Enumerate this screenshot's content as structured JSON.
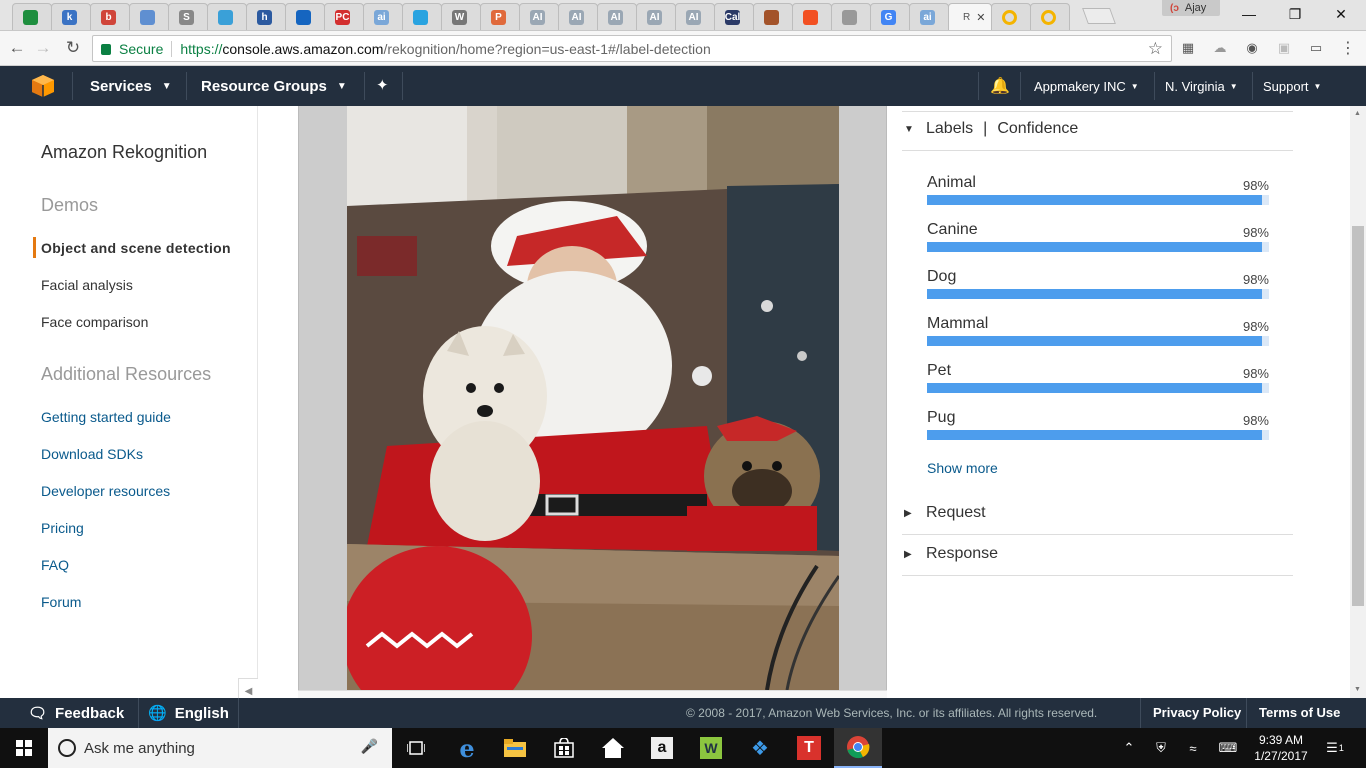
{
  "browser": {
    "tabs": [
      {
        "letter": "",
        "color": "#1e8e3e",
        "icon": "sheets-icon"
      },
      {
        "letter": "k",
        "color": "#3b73c4",
        "icon": "k-icon"
      },
      {
        "letter": "b",
        "color": "#d0453a",
        "icon": "b-icon"
      },
      {
        "letter": "",
        "color": "#5f8fd1",
        "icon": "doc-icon"
      },
      {
        "letter": "S",
        "color": "#888888",
        "icon": "s-icon"
      },
      {
        "letter": "",
        "color": "#3aa0d8",
        "icon": "circle-icon"
      },
      {
        "letter": "h",
        "color": "#2c5aa0",
        "icon": "h-icon"
      },
      {
        "letter": "",
        "color": "#1565c0",
        "icon": "globe-icon"
      },
      {
        "letter": "PC",
        "color": "#d32f2f",
        "icon": "pc-icon"
      },
      {
        "letter": "ai",
        "color": "#7aa7d8",
        "icon": "ai-icon"
      },
      {
        "letter": "",
        "color": "#29a3e0",
        "icon": "check-icon"
      },
      {
        "letter": "W",
        "color": "#777777",
        "icon": "wikipedia-icon"
      },
      {
        "letter": "P",
        "color": "#e06a3c",
        "icon": "p-icon"
      },
      {
        "letter": "AI",
        "color": "#9aa7b4",
        "icon": "ai-box-icon"
      },
      {
        "letter": "AI",
        "color": "#9aa7b4",
        "icon": "ai-box-icon"
      },
      {
        "letter": "AI",
        "color": "#9aa7b4",
        "icon": "ai-box-icon"
      },
      {
        "letter": "AI",
        "color": "#9aa7b4",
        "icon": "ai-box-icon"
      },
      {
        "letter": "AI",
        "color": "#9aa7b4",
        "icon": "ai-box-icon"
      },
      {
        "letter": "Cal",
        "color": "#2b3a67",
        "icon": "cal-icon"
      },
      {
        "letter": "",
        "color": "#a3532a",
        "icon": "shield-icon"
      },
      {
        "letter": "",
        "color": "#f25022",
        "icon": "microsoft-icon"
      },
      {
        "letter": "",
        "color": "#999999",
        "icon": "page-icon"
      },
      {
        "letter": "G",
        "color": "#4285f4",
        "icon": "google-icon"
      },
      {
        "letter": "ai",
        "color": "#7aa7d8",
        "icon": "ai-icon"
      }
    ],
    "active_tab": {
      "title": "R"
    },
    "extra_tabs": [
      {
        "icon": "google-drive-icon"
      },
      {
        "icon": "google-drive-icon"
      }
    ],
    "profile_name": "Ajay",
    "secure_label": "Secure",
    "url_scheme": "https://",
    "url_host": "console.aws.amazon.com",
    "url_path": "/rekognition/home?region=us-east-1#/label-detection"
  },
  "aws_nav": {
    "services": "Services",
    "resource_groups": "Resource Groups",
    "account": "Appmakery INC",
    "region": "N. Virginia",
    "support": "Support"
  },
  "sidebar": {
    "title": "Amazon Rekognition",
    "demos_heading": "Demos",
    "demos": [
      {
        "label": "Object and scene detection",
        "active": true
      },
      {
        "label": "Facial analysis",
        "active": false
      },
      {
        "label": "Face comparison",
        "active": false
      }
    ],
    "resources_heading": "Additional Resources",
    "resources": [
      {
        "label": "Getting started guide"
      },
      {
        "label": "Download SDKs"
      },
      {
        "label": "Developer resources"
      },
      {
        "label": "Pricing"
      },
      {
        "label": "FAQ"
      },
      {
        "label": "Forum"
      }
    ]
  },
  "results": {
    "header_labels": "Labels",
    "header_confidence": "Confidence",
    "labels": [
      {
        "name": "Animal",
        "confidence": "98%",
        "value": 0.98
      },
      {
        "name": "Canine",
        "confidence": "98%",
        "value": 0.98
      },
      {
        "name": "Dog",
        "confidence": "98%",
        "value": 0.98
      },
      {
        "name": "Mammal",
        "confidence": "98%",
        "value": 0.98
      },
      {
        "name": "Pet",
        "confidence": "98%",
        "value": 0.98
      },
      {
        "name": "Pug",
        "confidence": "98%",
        "value": 0.98
      }
    ],
    "show_more": "Show more",
    "request": "Request",
    "response": "Response"
  },
  "footer": {
    "feedback": "Feedback",
    "language": "English",
    "copyright": "© 2008 - 2017, Amazon Web Services, Inc. or its affiliates. All rights reserved.",
    "privacy": "Privacy Policy",
    "terms": "Terms of Use"
  },
  "taskbar": {
    "search_placeholder": "Ask me anything",
    "time": "9:39 AM",
    "date": "1/27/2017",
    "notification_count": "1"
  },
  "colors": {
    "aws_nav_bg": "#232f3e",
    "aws_orange": "#e47911",
    "bar_fill": "#4d9ded",
    "link_blue": "#0a5a8c"
  }
}
